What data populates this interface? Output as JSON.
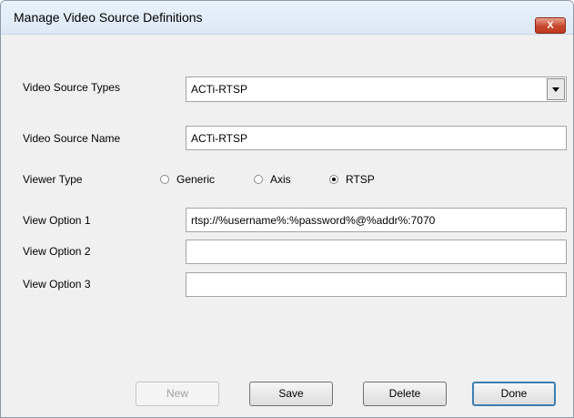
{
  "window": {
    "title": "Manage Video Source Definitions",
    "close_label": "X"
  },
  "form": {
    "video_source_types": {
      "label": "Video Source Types",
      "value": "ACTi-RTSP"
    },
    "video_source_name": {
      "label": "Video Source Name",
      "value": "ACTi-RTSP"
    },
    "viewer_type": {
      "label": "Viewer Type",
      "options": [
        {
          "label": "Generic",
          "selected": false
        },
        {
          "label": "Axis",
          "selected": false
        },
        {
          "label": "RTSP",
          "selected": true
        }
      ]
    },
    "view_option_1": {
      "label": "View Option 1",
      "value": "rtsp://%username%:%password%@%addr%:7070"
    },
    "view_option_2": {
      "label": "View Option 2",
      "value": ""
    },
    "view_option_3": {
      "label": "View Option 3",
      "value": ""
    }
  },
  "buttons": {
    "new": "New",
    "save": "Save",
    "delete": "Delete",
    "done": "Done"
  },
  "colors": {
    "title_bar": "#dce8f5",
    "close_button": "#c7482e",
    "dialog_bg": "#f0f0f0"
  }
}
